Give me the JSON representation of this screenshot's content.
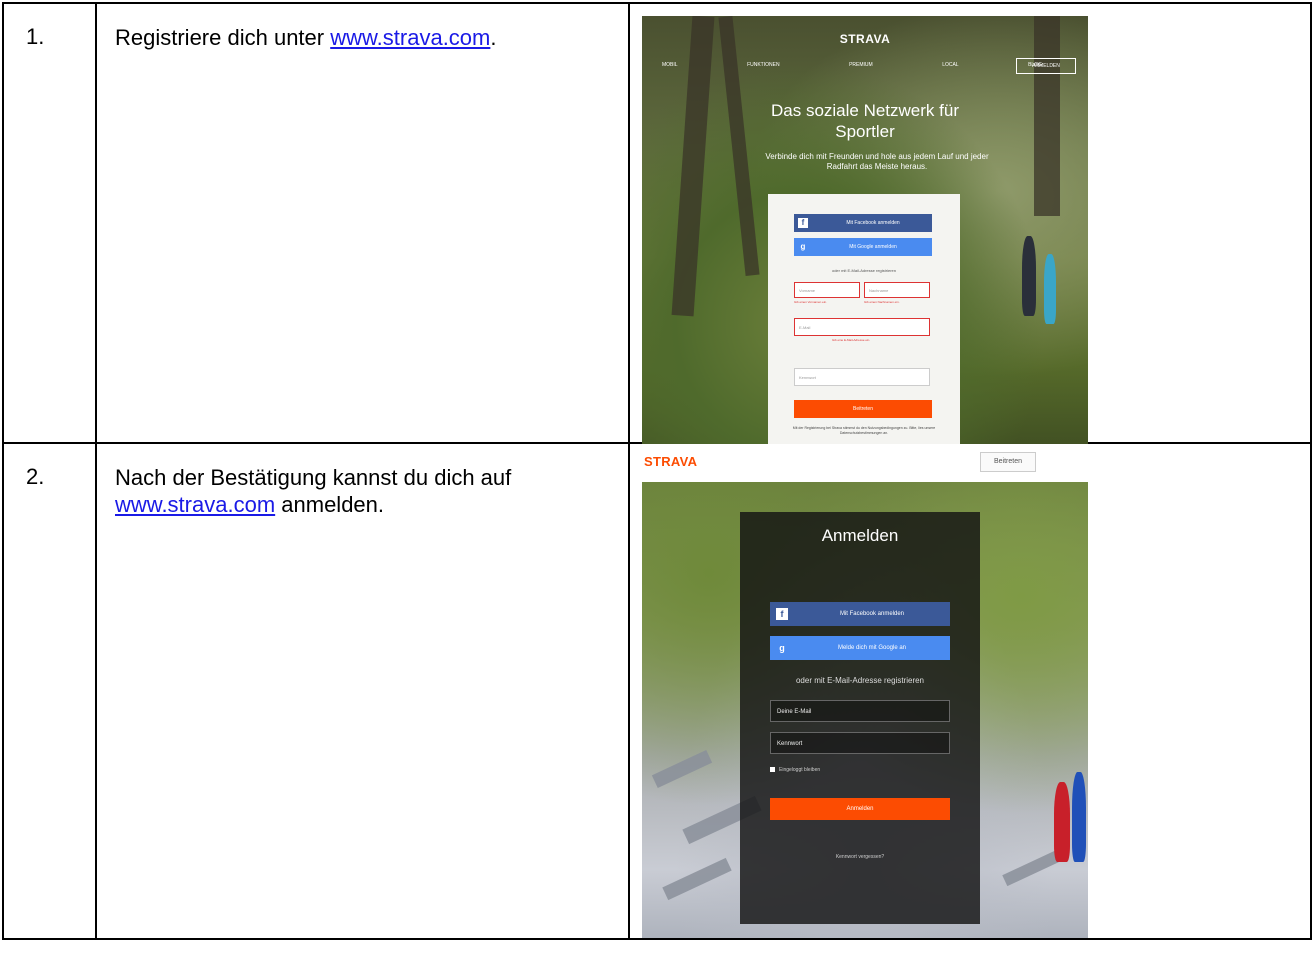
{
  "rows": [
    {
      "number": "1.",
      "text_before": "Registriere dich unter ",
      "link": "www.strava.com",
      "text_after": "."
    },
    {
      "number": "2.",
      "text_before": "Nach der Bestätigung kannst du dich auf ",
      "link": "www.strava.com",
      "text_after": " anmelden."
    }
  ],
  "shot1": {
    "logo": "STRAVA",
    "nav": [
      "MOBIL",
      "FUNKTIONEN",
      "PREMIUM",
      "LOCAL",
      "BLOG"
    ],
    "nav_button": "ANMELDEN",
    "headline": "Das soziale Netzwerk für Sportler",
    "subheadline": "Verbinde dich mit Freunden und hole aus jedem Lauf und jeder Radfahrt das Meiste heraus.",
    "facebook_button": "Mit Facebook anmelden",
    "google_button": "Mit Google anmelden",
    "or_text": "oder mit E-Mail-Adresse registrieren",
    "firstname_placeholder": "Vorname",
    "lastname_placeholder": "Nachname",
    "firstname_error": "Gib einen Vornamen ein.",
    "lastname_error": "Gib einen Nachnamen ein.",
    "email_placeholder": "E-Mail",
    "email_error": "Gib eine E-Mail-Adresse ein.",
    "password_placeholder": "Kennwort",
    "submit": "Beitreten",
    "terms": "Mit der Registrierung bei Strava stimmst du den Nutzungsbedingungen zu. Bitte, lies unsere Datenschutzbestimmungen an."
  },
  "shot2": {
    "logo": "STRAVA",
    "join_button": "Beitreten",
    "title": "Anmelden",
    "facebook_button": "Mit Facebook anmelden",
    "google_button": "Melde dich mit Google an",
    "or_text": "oder mit E-Mail-Adresse registrieren",
    "email_placeholder": "Deine E-Mail",
    "password_placeholder": "Kennwort",
    "remember": "Eingeloggt bleiben",
    "submit": "Anmelden",
    "forgot": "Kennwort vergessen?"
  },
  "colors": {
    "strava_orange": "#fc4c02",
    "facebook_blue": "#3b5998",
    "google_blue": "#4a8bf0",
    "link_blue": "#1a1ae6"
  }
}
